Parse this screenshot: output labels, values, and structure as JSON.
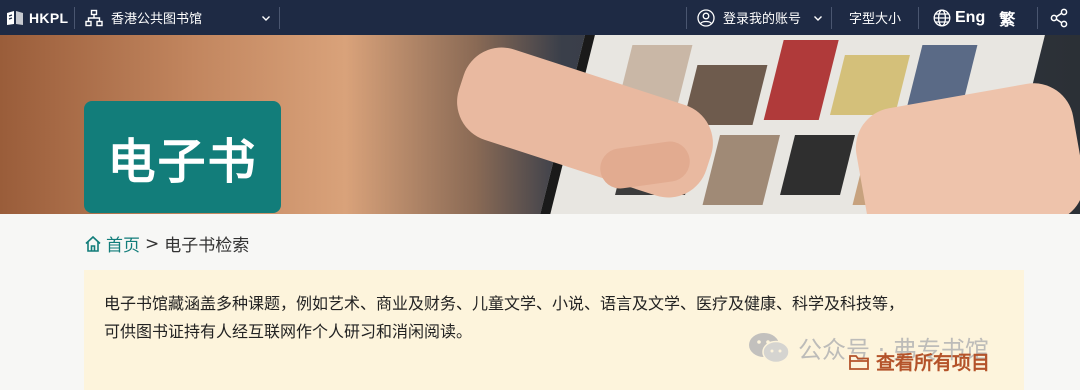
{
  "header": {
    "logo_text": "HKPL",
    "library_select": "香港公共图书馆",
    "account_label": "登录我的账号",
    "font_size_label": "字型大小",
    "lang_en": "Eng",
    "lang_trad": "繁",
    "icons": [
      "hkpl-logo-icon",
      "library-tree-icon",
      "chevron-down-icon",
      "user-icon",
      "globe-icon",
      "share-icon"
    ]
  },
  "hero": {
    "title": "电子书"
  },
  "breadcrumb": {
    "home": "首页",
    "separator": ">",
    "current": "电子书检索"
  },
  "info": {
    "line1": "电子书馆藏涵盖多种课题，例如艺术、商业及财务、儿童文学、小说、语言及文学、医疗及健康、科学及科技等，",
    "line2": "可供图书证持有人经互联网作个人研习和消闲阅读。"
  },
  "watermark": "公众号 · 弗专书馆",
  "view_all": "查看所有项目",
  "colors": {
    "topbar": "#1e2a44",
    "accent_teal": "#127d7a",
    "info_bg": "#fdf4dc",
    "link_orange": "#b4532a"
  }
}
